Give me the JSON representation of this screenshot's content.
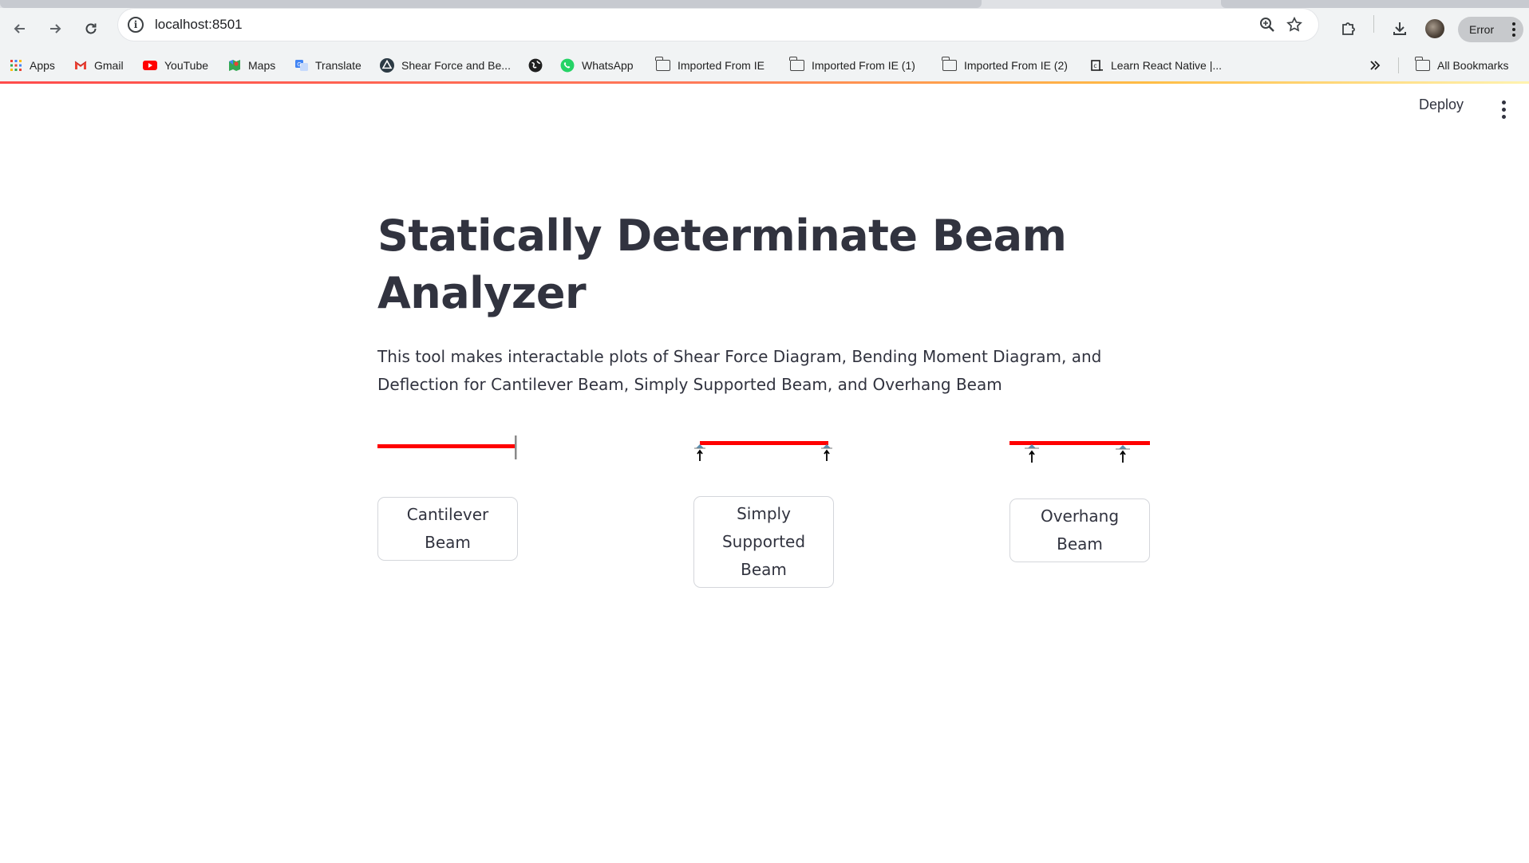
{
  "browser": {
    "url": "localhost:8501",
    "profile_status": "Error",
    "bookmarks": [
      {
        "label": "Apps",
        "icon": "apps-grid-icon"
      },
      {
        "label": "Gmail",
        "icon": "gmail-icon"
      },
      {
        "label": "YouTube",
        "icon": "youtube-icon"
      },
      {
        "label": "Maps",
        "icon": "maps-icon"
      },
      {
        "label": "Translate",
        "icon": "translate-icon"
      },
      {
        "label": "Shear Force and Be...",
        "icon": "site-triangle-icon"
      },
      {
        "label": "",
        "icon": "globe-icon"
      },
      {
        "label": "WhatsApp",
        "icon": "whatsapp-icon"
      },
      {
        "label": "Imported From IE",
        "icon": "folder-icon"
      },
      {
        "label": "Imported From IE (1)",
        "icon": "folder-icon"
      },
      {
        "label": "Imported From IE (2)",
        "icon": "folder-icon"
      },
      {
        "label": "Learn React Native |...",
        "icon": "site-code-icon"
      }
    ],
    "all_bookmarks": "All Bookmarks",
    "colors": {
      "chrome_bg": "#f1f3f4",
      "accent_bar_start": "#ff4b4b",
      "accent_bar_end": "#fff3b0"
    }
  },
  "app": {
    "deploy_label": "Deploy",
    "title": "Statically Determinate Beam Analyzer",
    "description": "This tool makes interactable plots of Shear Force Diagram, Bending Moment Diagram, and Deflection for Cantilever Beam, Simply Supported Beam, and Overhang Beam",
    "beams": [
      {
        "label": "Cantilever Beam",
        "diagram": "cantilever"
      },
      {
        "label": "Simply Supported Beam",
        "diagram": "simply-supported"
      },
      {
        "label": "Overhang Beam",
        "diagram": "overhang"
      }
    ],
    "colors": {
      "text": "#31333f",
      "beam": "#ff0000",
      "button_border": "#d4d6db"
    }
  }
}
